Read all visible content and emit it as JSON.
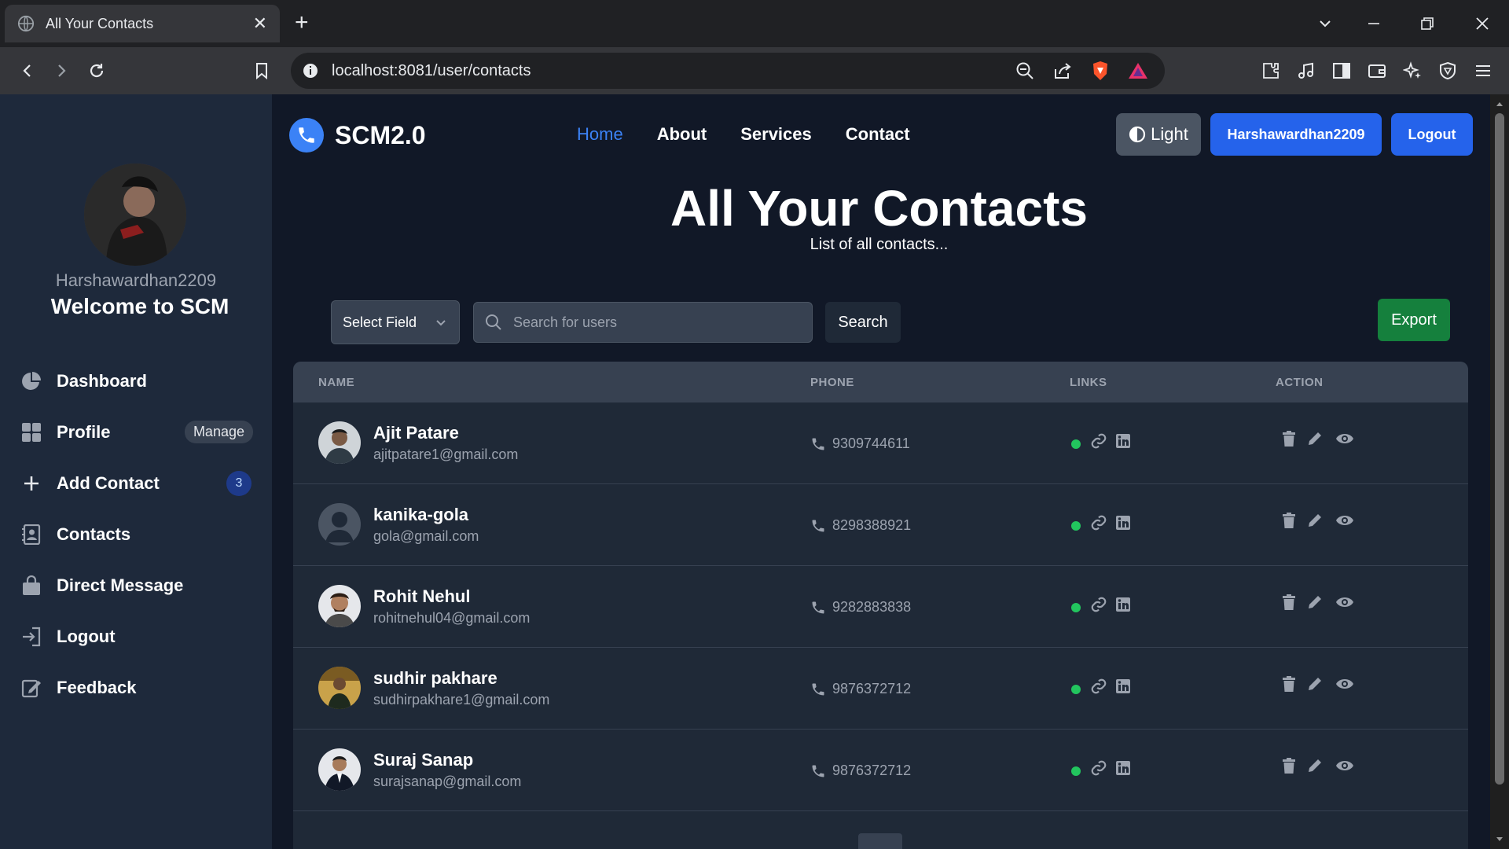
{
  "browser": {
    "tab_title": "All Your Contacts",
    "url": "localhost:8081/user/contacts"
  },
  "sidebar": {
    "username": "Harshawardhan2209",
    "welcome": "Welcome to SCM",
    "items": [
      {
        "label": "Dashboard",
        "icon": "pie-chart-icon"
      },
      {
        "label": "Profile",
        "icon": "grid-icon",
        "badge": "Manage"
      },
      {
        "label": "Add Contact",
        "icon": "plus-icon",
        "count": "3"
      },
      {
        "label": "Contacts",
        "icon": "address-book-icon"
      },
      {
        "label": "Direct Message",
        "icon": "bag-icon"
      },
      {
        "label": "Logout",
        "icon": "logout-icon"
      },
      {
        "label": "Feedback",
        "icon": "feedback-icon"
      }
    ]
  },
  "header": {
    "brand": "SCM2.0",
    "nav": [
      "Home",
      "About",
      "Services",
      "Contact"
    ],
    "theme_label": "Light",
    "user_button": "Harshawardhan2209",
    "logout_button": "Logout"
  },
  "main": {
    "title": "All Your Contacts",
    "subtitle": "List of all contacts...",
    "select_field": "Select Field",
    "search_placeholder": "Search for users",
    "search_button": "Search",
    "export_button": "Export"
  },
  "table": {
    "headers": [
      "NAME",
      "PHONE",
      "LINKS",
      "ACTION"
    ],
    "rows": [
      {
        "name": "Ajit Patare",
        "email": "ajitpatare1@gmail.com",
        "phone": "9309744611"
      },
      {
        "name": "kanika-gola",
        "email": "gola@gmail.com",
        "phone": "8298388921"
      },
      {
        "name": "Rohit Nehul",
        "email": "rohitnehul04@gmail.com",
        "phone": "9282883838"
      },
      {
        "name": "sudhir pakhare",
        "email": "sudhirpakhare1@gmail.com",
        "phone": "9876372712"
      },
      {
        "name": "Suraj Sanap",
        "email": "surajsanap@gmail.com",
        "phone": "9876372712"
      }
    ]
  },
  "colors": {
    "accent": "#2563eb",
    "export": "#15803d",
    "online": "#22c55e",
    "sidebar_bg": "#1e293b",
    "page_bg": "#111827"
  }
}
